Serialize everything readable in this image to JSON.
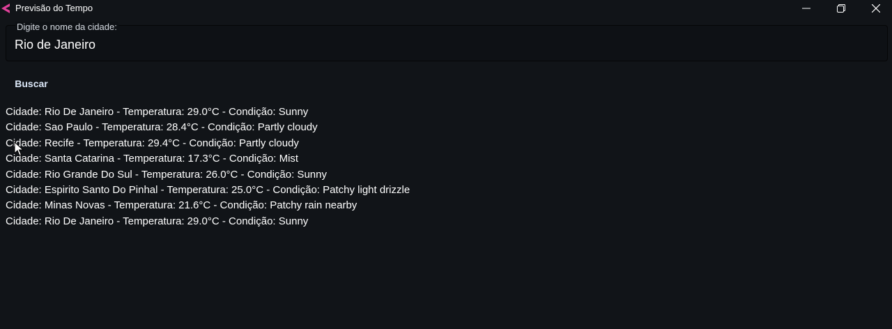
{
  "window": {
    "title": "Previsão do Tempo",
    "icon": "flutter-logo-icon",
    "accent_color": "#e0409a"
  },
  "search": {
    "label": "Digite o nome da cidade:",
    "value": "Rio de Janeiro",
    "button_label": "Buscar"
  },
  "results": [
    "Cidade: Rio De Janeiro - Temperatura: 29.0°C - Condição: Sunny",
    "Cidade: Sao Paulo - Temperatura: 28.4°C - Condição: Partly cloudy",
    "Cidade: Recife - Temperatura: 29.4°C - Condição: Partly cloudy",
    "Cidade: Santa Catarina - Temperatura: 17.3°C - Condição: Mist",
    "Cidade: Rio Grande Do Sul - Temperatura: 26.0°C - Condição: Sunny",
    "Cidade: Espirito Santo Do Pinhal - Temperatura: 25.0°C - Condição: Patchy light drizzle",
    "Cidade: Minas Novas - Temperatura: 21.6°C - Condição: Patchy rain nearby",
    "Cidade: Rio De Janeiro - Temperatura: 29.0°C - Condição: Sunny"
  ]
}
